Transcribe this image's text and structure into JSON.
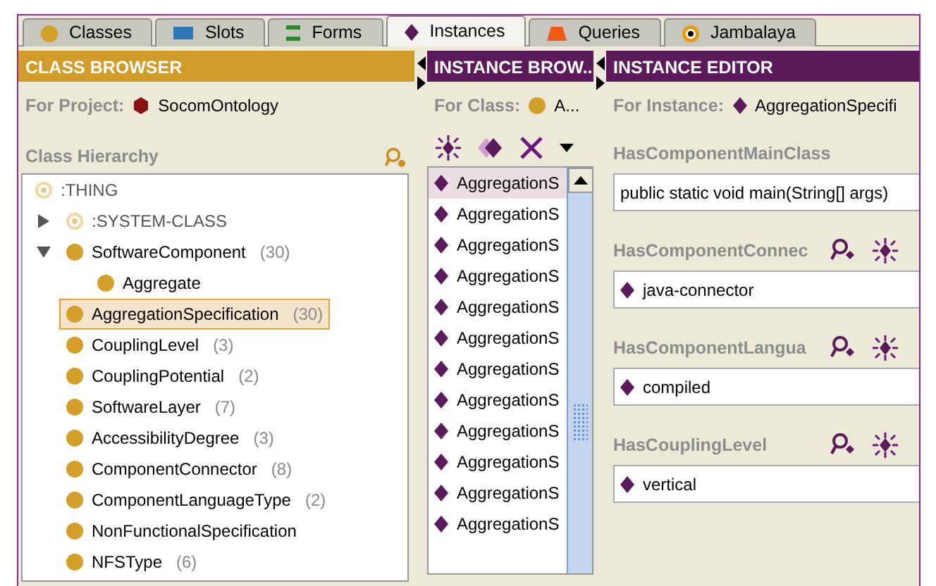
{
  "tabs": [
    {
      "label": "Classes",
      "kind": "class",
      "selected": false
    },
    {
      "label": "Slots",
      "kind": "slot",
      "selected": false
    },
    {
      "label": "Forms",
      "kind": "form",
      "selected": false
    },
    {
      "label": "Instances",
      "kind": "instance",
      "selected": true
    },
    {
      "label": "Queries",
      "kind": "query",
      "selected": false
    },
    {
      "label": "Jambalaya",
      "kind": "jambalaya",
      "selected": false
    }
  ],
  "class_browser": {
    "title": "CLASS BROWSER",
    "project_label": "For Project:",
    "project": "SocomOntology",
    "hierarchy_label": "Class Hierarchy",
    "tree": [
      {
        "label": ":THING",
        "kind": "abstract",
        "selected": false,
        "children": [
          {
            "label": ":SYSTEM-CLASS",
            "kind": "abstract",
            "selected": false,
            "expanded": false
          },
          {
            "label": "SoftwareComponent",
            "count": "(30)",
            "kind": "class",
            "selected": false,
            "expanded": true,
            "children": [
              {
                "label": "Aggregate",
                "kind": "class",
                "selected": false
              }
            ]
          },
          {
            "label": "AggregationSpecification",
            "count": "(30)",
            "kind": "class",
            "selected": true
          },
          {
            "label": "CouplingLevel",
            "count": "(3)",
            "kind": "class",
            "selected": false
          },
          {
            "label": "CouplingPotential",
            "count": "(2)",
            "kind": "class",
            "selected": false
          },
          {
            "label": "SoftwareLayer",
            "count": "(7)",
            "kind": "class",
            "selected": false
          },
          {
            "label": "AccessibilityDegree",
            "count": "(3)",
            "kind": "class",
            "selected": false
          },
          {
            "label": "ComponentConnector",
            "count": "(8)",
            "kind": "class",
            "selected": false
          },
          {
            "label": "ComponentLanguageType",
            "count": "(2)",
            "kind": "class",
            "selected": false
          },
          {
            "label": "NonFunctionalSpecification",
            "kind": "class",
            "selected": false
          },
          {
            "label": "NFSType",
            "count": "(6)",
            "kind": "class",
            "selected": false
          }
        ]
      }
    ]
  },
  "instance_browser": {
    "title": "INSTANCE BROW...",
    "class_label": "For Class:",
    "class": "A...",
    "instances": [
      {
        "label": "AggregationS",
        "selected": true
      },
      {
        "label": "AggregationS",
        "selected": false
      },
      {
        "label": "AggregationS",
        "selected": false
      },
      {
        "label": "AggregationS",
        "selected": false
      },
      {
        "label": "AggregationS",
        "selected": false
      },
      {
        "label": "AggregationS",
        "selected": false
      },
      {
        "label": "AggregationS",
        "selected": false
      },
      {
        "label": "AggregationS",
        "selected": false
      },
      {
        "label": "AggregationS",
        "selected": false
      },
      {
        "label": "AggregationS",
        "selected": false
      },
      {
        "label": "AggregationS",
        "selected": false
      },
      {
        "label": "AggregationS",
        "selected": false
      }
    ]
  },
  "instance_editor": {
    "title": "INSTANCE EDITOR",
    "instance_label": "For Instance:",
    "instance": "AggregationSpecifi",
    "slots": [
      {
        "label": "HasComponentMainClass",
        "kind": "text",
        "value": "public static void main(String[] args)"
      },
      {
        "label": "HasComponentConnec",
        "kind": "instance",
        "value": "java-connector"
      },
      {
        "label": "HasComponentLangua",
        "kind": "instance",
        "value": "compiled"
      },
      {
        "label": "HasCouplingLevel",
        "kind": "instance",
        "value": "vertical"
      }
    ]
  }
}
